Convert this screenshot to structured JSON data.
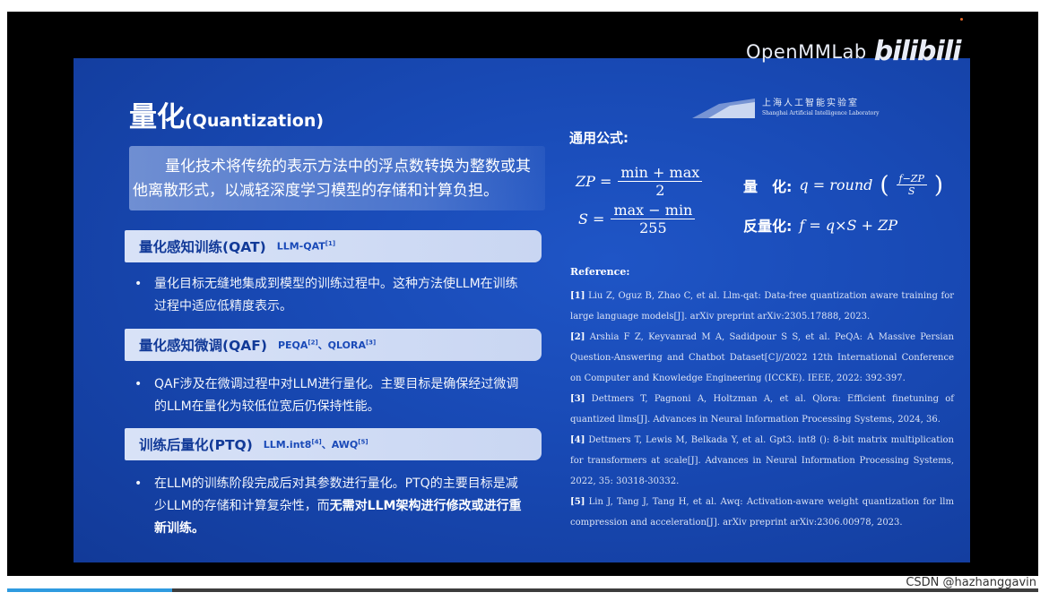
{
  "watermark": {
    "openmmlab": "OpenMMLab",
    "bilibili": "bilibili",
    "csdn": "CSDN @hazhanggavin"
  },
  "video": {
    "progress_fraction": 0.16
  },
  "slide": {
    "title_zh": "量化",
    "title_en": "(Quantization)",
    "intro": "量化技术将传统的表示方法中的浮点数转换为整数或其他离散形式，以减轻深度学习模型的存储和计算负担。",
    "lab": {
      "name_zh": "上海人工智能实验室",
      "name_en": "Shanghai Artificial Intelligence Laboratory"
    },
    "sections": [
      {
        "label": "量化感知训练(QAT)",
        "refs": [
          {
            "text": "LLM-QAT",
            "sup": "[1]"
          }
        ],
        "bullet": "量化目标无缝地集成到模型的训练过程中。这种方法使LLM在训练过程中适应低精度表示。",
        "bullet_bold": ""
      },
      {
        "label": "量化感知微调(QAF)",
        "refs": [
          {
            "text": "PEQA",
            "sup": "[2]"
          },
          {
            "text": "QLORA",
            "sup": "[3]"
          }
        ],
        "bullet": "QAF涉及在微调过程中对LLM进行量化。主要目标是确保经过微调的LLM在量化为较低位宽后仍保持性能。",
        "bullet_bold": ""
      },
      {
        "label": "训练后量化(PTQ)",
        "refs": [
          {
            "text": "LLM.int8",
            "sup": "[4]"
          },
          {
            "text": "AWQ",
            "sup": "[5]"
          }
        ],
        "bullet": "在LLM的训练阶段完成后对其参数进行量化。PTQ的主要目标是减少LLM的存储和计算复杂性，而",
        "bullet_bold": "无需对LLM架构进行修改或进行重新训练。"
      }
    ],
    "ref_separator": "、",
    "bullet_symbol": "•",
    "formula": {
      "heading": "通用公式:",
      "zp_lhs": "ZP =",
      "zp_num": "min + max",
      "zp_den": "2",
      "s_lhs": "S =",
      "s_num": "max − min",
      "s_den": "255",
      "quant_label": "量　化:",
      "quant_expr": "q = round",
      "quant_num": "f−ZP",
      "quant_den": "S",
      "dequant_label": "反量化:",
      "dequant_expr": "f = q×S + ZP"
    },
    "reference_heading": "Reference:",
    "references": [
      {
        "num": "[1]",
        "text": "Liu Z, Oguz B, Zhao C, et al. Llm-qat: Data-free quantization aware training for large language models[J]. arXiv preprint arXiv:2305.17888, 2023."
      },
      {
        "num": "[2]",
        "text": "Arshia F Z, Keyvanrad M A, Sadidpour S S, et al. PeQA: A Massive Persian Question-Answering and Chatbot Dataset[C]//2022 12th International Conference on Computer and Knowledge Engineering (ICCKE). IEEE, 2022: 392-397."
      },
      {
        "num": "[3]",
        "text": "Dettmers T, Pagnoni A, Holtzman A, et al. Qlora: Efficient finetuning of quantized llms[J]. Advances in Neural Information Processing Systems, 2024, 36."
      },
      {
        "num": "[4]",
        "text": "Dettmers T, Lewis M, Belkada Y, et al. Gpt3. int8 (): 8-bit matrix multiplication for transformers at scale[J]. Advances in Neural Information Processing Systems, 2022, 35: 30318-30332."
      },
      {
        "num": "[5]",
        "text": "Lin J, Tang J, Tang H, et al. Awq: Activation-aware weight quantization for llm compression and acceleration[J]. arXiv preprint arXiv:2306.00978, 2023."
      }
    ]
  }
}
